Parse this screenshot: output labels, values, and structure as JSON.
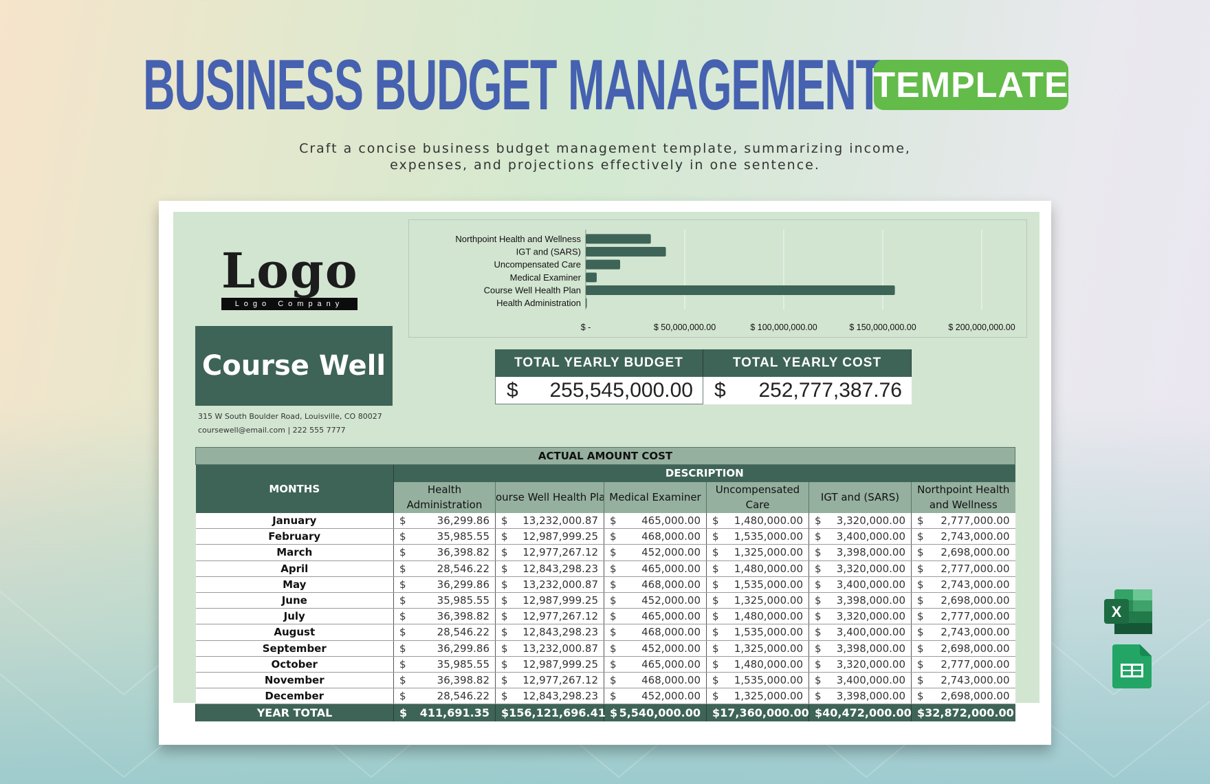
{
  "header": {
    "title": "BUSINESS BUDGET MANAGEMENT",
    "badge": "TEMPLATE",
    "subtitle_line1": "Craft a concise business budget management template, summarizing income,",
    "subtitle_line2": "expenses, and projections effectively in one sentence."
  },
  "company": {
    "logo_text": "Logo",
    "logo_subtext": "Logo Company",
    "name": "Course Well",
    "address": "315 W South Boulder Road, Louisville, CO 80027",
    "contact": "coursewell@email.com  |  222 555 7777"
  },
  "totals": {
    "budget_label": "TOTAL YEARLY BUDGET",
    "budget_currency": "$",
    "budget_value": "255,545,000.00",
    "cost_label": "TOTAL YEARLY COST",
    "cost_currency": "$",
    "cost_value": "252,777,387.76"
  },
  "chart_data": {
    "type": "bar",
    "orientation": "horizontal",
    "title": "",
    "xlabel": "",
    "ylabel": "",
    "categories": [
      "Northpoint Health and Wellness",
      "IGT and (SARS)",
      "Uncompensated Care",
      "Medical Examiner",
      "Course Well Health  Plan",
      "Health Administration"
    ],
    "values": [
      32872000,
      40472000,
      17360000,
      5540000,
      156121696.41,
      411691.35
    ],
    "xlim": [
      0,
      200000000
    ],
    "x_ticks": [
      0,
      50000000,
      100000000,
      150000000,
      200000000
    ],
    "x_tick_labels": [
      "$ -",
      "$ 50,000,000.00",
      "$ 100,000,000.00",
      "$ 150,000,000.00",
      "$ 200,000,000.00"
    ],
    "grid": true,
    "bar_color": "#3e6457"
  },
  "table": {
    "title": "ACTUAL AMOUNT COST",
    "months_header": "MONTHS",
    "description_header": "DESCRIPTION",
    "columns": [
      [
        "Health",
        "Administration"
      ],
      [
        "ourse Well Health  Pla",
        ""
      ],
      [
        "Medical Examiner",
        ""
      ],
      [
        "Uncompensated",
        "Care"
      ],
      [
        "IGT and (SARS)",
        ""
      ],
      [
        "Northpoint Health",
        "and Wellness"
      ]
    ],
    "currency": "$",
    "rows": [
      {
        "month": "January",
        "values": [
          "36,299.86",
          "13,232,000.87",
          "465,000.00",
          "1,480,000.00",
          "3,320,000.00",
          "2,777,000.00"
        ]
      },
      {
        "month": "February",
        "values": [
          "35,985.55",
          "12,987,999.25",
          "468,000.00",
          "1,535,000.00",
          "3,400,000.00",
          "2,743,000.00"
        ]
      },
      {
        "month": "March",
        "values": [
          "36,398.82",
          "12,977,267.12",
          "452,000.00",
          "1,325,000.00",
          "3,398,000.00",
          "2,698,000.00"
        ]
      },
      {
        "month": "April",
        "values": [
          "28,546.22",
          "12,843,298.23",
          "465,000.00",
          "1,480,000.00",
          "3,320,000.00",
          "2,777,000.00"
        ]
      },
      {
        "month": "May",
        "values": [
          "36,299.86",
          "13,232,000.87",
          "468,000.00",
          "1,535,000.00",
          "3,400,000.00",
          "2,743,000.00"
        ]
      },
      {
        "month": "June",
        "values": [
          "35,985.55",
          "12,987,999.25",
          "452,000.00",
          "1,325,000.00",
          "3,398,000.00",
          "2,698,000.00"
        ]
      },
      {
        "month": "July",
        "values": [
          "36,398.82",
          "12,977,267.12",
          "465,000.00",
          "1,480,000.00",
          "3,320,000.00",
          "2,777,000.00"
        ]
      },
      {
        "month": "August",
        "values": [
          "28,546.22",
          "12,843,298.23",
          "468,000.00",
          "1,535,000.00",
          "3,400,000.00",
          "2,743,000.00"
        ]
      },
      {
        "month": "September",
        "values": [
          "36,299.86",
          "13,232,000.87",
          "452,000.00",
          "1,325,000.00",
          "3,398,000.00",
          "2,698,000.00"
        ]
      },
      {
        "month": "October",
        "values": [
          "35,985.55",
          "12,987,999.25",
          "465,000.00",
          "1,480,000.00",
          "3,320,000.00",
          "2,777,000.00"
        ]
      },
      {
        "month": "November",
        "values": [
          "36,398.82",
          "12,977,267.12",
          "468,000.00",
          "1,535,000.00",
          "3,400,000.00",
          "2,743,000.00"
        ]
      },
      {
        "month": "December",
        "values": [
          "28,546.22",
          "12,843,298.23",
          "452,000.00",
          "1,325,000.00",
          "3,398,000.00",
          "2,698,000.00"
        ]
      }
    ],
    "total_label": "YEAR TOTAL",
    "totals": [
      "411,691.35",
      "156,121,696.41",
      "5,540,000.00",
      "17,360,000.00",
      "40,472,000.00",
      "32,872,000.00"
    ]
  },
  "file_icons": [
    {
      "name": "excel-icon",
      "letter": "X"
    },
    {
      "name": "google-sheets-icon"
    }
  ],
  "colors": {
    "title": "#4561b0",
    "badge": "#63bb4a",
    "dark_green": "#3e6457",
    "mid_green": "#95b09f",
    "sheet_bg": "#d2e5d1"
  }
}
